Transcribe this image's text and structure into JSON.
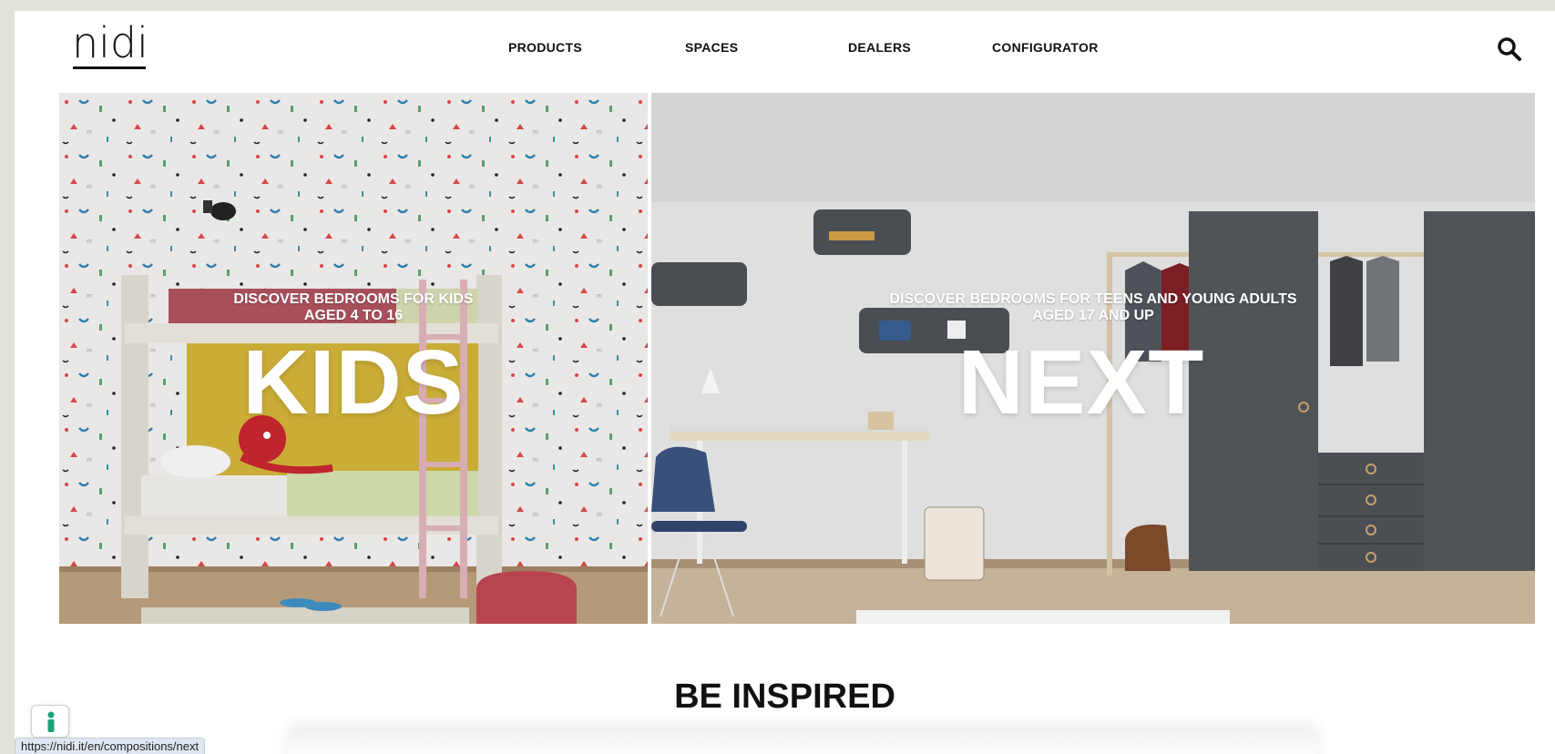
{
  "header": {
    "logo": "nidi",
    "nav": [
      {
        "label": "PRODUCTS"
      },
      {
        "label": "SPACES"
      },
      {
        "label": "DEALERS"
      },
      {
        "label": "CONFIGURATOR"
      }
    ],
    "search_icon": "search-icon"
  },
  "hero": {
    "kids": {
      "line1": "DISCOVER BEDROOMS FOR KIDS",
      "line2": "AGED 4 TO 16",
      "title": "KIDS"
    },
    "next": {
      "line1": "DISCOVER BEDROOMS FOR TEENS AND YOUNG ADULTS",
      "line2": "AGED 17 AND UP",
      "title": "NEXT"
    }
  },
  "section": {
    "title": "BE INSPIRED"
  },
  "accessibility": {
    "icon": "accessibility-icon",
    "color": "#1aa37a"
  },
  "status_bar": {
    "url": "https://nidi.it/en/compositions/next"
  }
}
